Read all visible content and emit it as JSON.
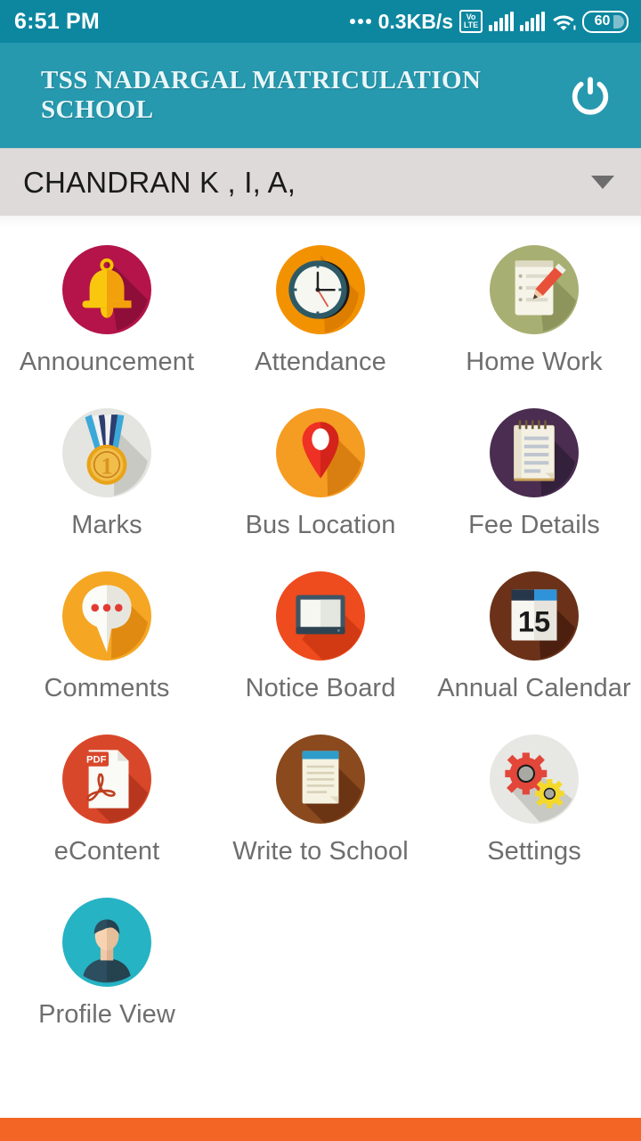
{
  "status_bar": {
    "time": "6:51 PM",
    "network_speed": "0.3KB/s",
    "volte_top": "Vo",
    "volte_bottom": "LTE",
    "battery_percent": "60",
    "wifi_icon": "wifi-icon",
    "signal_icon": "signal-bars-icon"
  },
  "app_bar": {
    "title": "TSS NADARGAL MATRICULATION SCHOOL",
    "logout_icon": "power-icon",
    "background_color": "#2699AF"
  },
  "selector": {
    "value": "CHANDRAN K , I, A,",
    "caret_icon": "chevron-down-icon"
  },
  "menu": {
    "items": [
      {
        "label": "Announcement",
        "icon": "bell-icon",
        "circle_color": "#B4144A"
      },
      {
        "label": "Attendance",
        "icon": "clock-icon",
        "circle_color": "#F39200"
      },
      {
        "label": "Home Work",
        "icon": "notepad-pencil-icon",
        "circle_color": "#A8AF72"
      },
      {
        "label": "Marks",
        "icon": "medal-icon",
        "circle_color": "#E4E4E0"
      },
      {
        "label": "Bus Location",
        "icon": "map-pin-icon",
        "circle_color": "#F59C22"
      },
      {
        "label": "Fee Details",
        "icon": "notebook-icon",
        "circle_color": "#4A2D51"
      },
      {
        "label": "Comments",
        "icon": "speech-bubble-icon",
        "circle_color": "#F5A623"
      },
      {
        "label": "Notice Board",
        "icon": "whiteboard-icon",
        "circle_color": "#EE4B1E"
      },
      {
        "label": "Annual Calendar",
        "icon": "calendar-icon",
        "circle_color": "#6B3219"
      },
      {
        "label": "eContent",
        "icon": "pdf-icon",
        "circle_color": "#D9472A"
      },
      {
        "label": "Write to School",
        "icon": "writing-pad-icon",
        "circle_color": "#8A4A1E"
      },
      {
        "label": "Settings",
        "icon": "gears-icon",
        "circle_color": "#E7E7E3"
      },
      {
        "label": "Profile View",
        "icon": "user-avatar-icon",
        "circle_color": "#26B3C4"
      }
    ],
    "calendar_day": "15",
    "medal_number": "1",
    "pdf_label": "PDF"
  },
  "bottom_bar": {
    "color": "#F26524"
  }
}
